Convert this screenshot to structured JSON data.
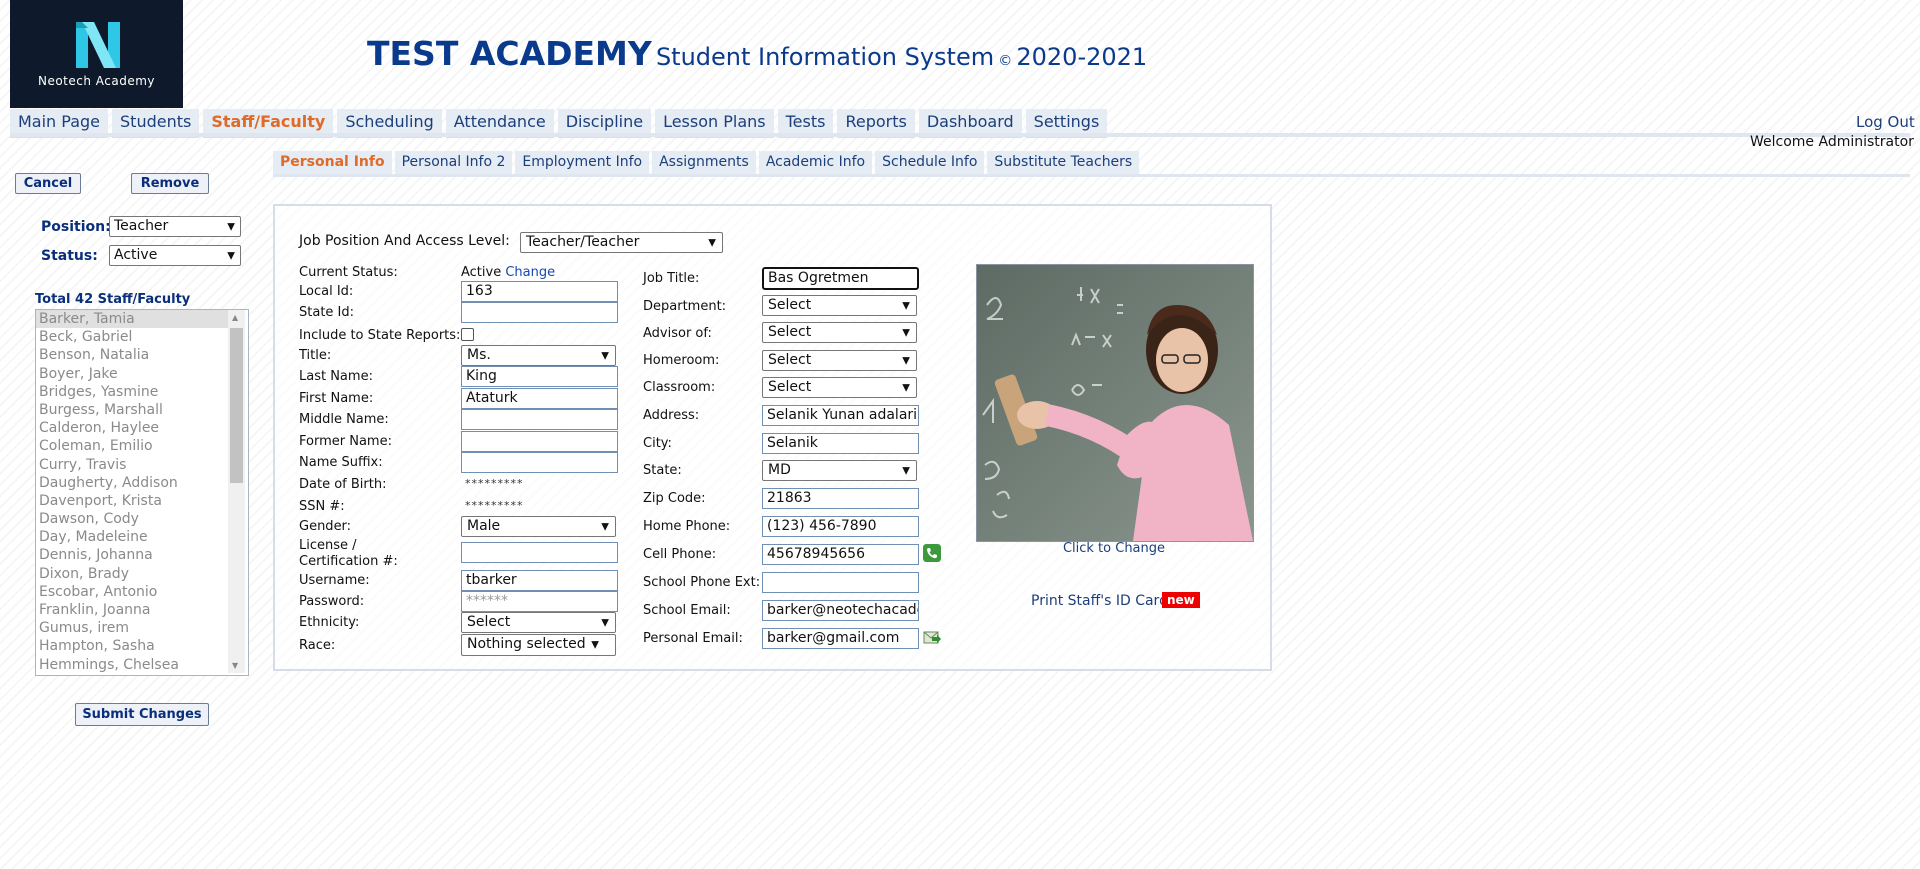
{
  "header": {
    "logo_text": "Neotech Academy",
    "title_bold": "TEST ACADEMY",
    "title_rest": "Student Information System",
    "copyright": "©",
    "year": "2020-2021"
  },
  "main_nav": [
    {
      "label": "Main Page",
      "active": false
    },
    {
      "label": "Students",
      "active": false
    },
    {
      "label": "Staff/Faculty",
      "active": true
    },
    {
      "label": "Scheduling",
      "active": false
    },
    {
      "label": "Attendance",
      "active": false
    },
    {
      "label": "Discipline",
      "active": false
    },
    {
      "label": "Lesson Plans",
      "active": false
    },
    {
      "label": "Tests",
      "active": false
    },
    {
      "label": "Reports",
      "active": false
    },
    {
      "label": "Dashboard",
      "active": false
    },
    {
      "label": "Settings",
      "active": false
    }
  ],
  "logout": "Log Out",
  "welcome": "Welcome Administrator",
  "sub_nav": [
    {
      "label": "Personal Info",
      "active": true
    },
    {
      "label": "Personal Info 2",
      "active": false
    },
    {
      "label": "Employment Info",
      "active": false
    },
    {
      "label": "Assignments",
      "active": false
    },
    {
      "label": "Academic Info",
      "active": false
    },
    {
      "label": "Schedule Info",
      "active": false
    },
    {
      "label": "Substitute Teachers",
      "active": false
    }
  ],
  "left": {
    "cancel": "Cancel",
    "remove": "Remove",
    "position_label": "Position:",
    "position_value": "Teacher",
    "status_label": "Status:",
    "status_value": "Active",
    "total": "Total 42 Staff/Faculty",
    "staff": [
      "Barker, Tamia",
      "Beck, Gabriel",
      "Benson, Natalia",
      "Boyer, Jake",
      "Bridges, Yasmine",
      "Burgess, Marshall",
      "Calderon, Haylee",
      "Coleman, Emilio",
      "Curry, Travis",
      "Daugherty, Addison",
      "Davenport, Krista",
      "Dawson, Cody",
      "Day, Madeleine",
      "Dennis, Johanna",
      "Dixon, Brady",
      "Escobar, Antonio",
      "Franklin, Joanna",
      "Gumus, irem",
      "Hampton, Sasha",
      "Hemmings, Chelsea"
    ],
    "submit": "Submit Changes"
  },
  "form": {
    "job_position_label": "Job Position And Access Level:",
    "job_position_value": "Teacher/Teacher",
    "current_status_label": "Current Status:",
    "current_status_value": "Active",
    "change_link": "Change",
    "local_id_label": "Local Id:",
    "local_id": "163",
    "state_id_label": "State Id:",
    "state_id": "",
    "include_state_label": "Include to State Reports:",
    "title_label": "Title:",
    "title_value": "Ms.",
    "last_name_label": "Last Name:",
    "last_name": "King",
    "first_name_label": "First Name:",
    "first_name": "Ataturk",
    "middle_name_label": "Middle Name:",
    "middle_name": "",
    "former_name_label": "Former Name:",
    "former_name": "",
    "name_suffix_label": "Name Suffix:",
    "name_suffix": "",
    "dob_label": "Date of Birth:",
    "dob_masked": "*********",
    "ssn_label": "SSN #:",
    "ssn_masked": "*********",
    "gender_label": "Gender:",
    "gender_value": "Male",
    "license_label_1": "License /",
    "license_label_2": "Certification #:",
    "license": "",
    "username_label": "Username:",
    "username": "tbarker",
    "password_label": "Password:",
    "password_masked": "******",
    "ethnicity_label": "Ethnicity:",
    "ethnicity_value": "Select",
    "race_label": "Race:",
    "race_value": "Nothing selected",
    "job_title_label": "Job Title:",
    "job_title": "Bas Ogretmen",
    "department_label": "Department:",
    "department_value": "Select",
    "advisor_label": "Advisor of:",
    "advisor_value": "Select",
    "homeroom_label": "Homeroom:",
    "homeroom_value": "Select",
    "classroom_label": "Classroom:",
    "classroom_value": "Select",
    "address_label": "Address:",
    "address": "Selanik Yunan adalari",
    "city_label": "City:",
    "city": "Selanik",
    "state_label": "State:",
    "state_value": "MD",
    "zip_label": "Zip Code:",
    "zip": "21863",
    "home_phone_label": "Home Phone:",
    "home_phone": "(123) 456-7890",
    "cell_phone_label": "Cell Phone:",
    "cell_phone": "45678945656",
    "school_phone_label": "School Phone Ext:",
    "school_phone": "",
    "school_email_label": "School Email:",
    "school_email": "barker@neotechacademy",
    "personal_email_label": "Personal Email:",
    "personal_email": "barker@gmail.com",
    "photo_caption": "Click to Change",
    "print_id": "Print Staff's ID Card",
    "new_badge": "new"
  },
  "colors": {
    "brand_blue": "#0a3a8c",
    "active_tab": "#e06a28",
    "badge_red": "#ee0000"
  }
}
